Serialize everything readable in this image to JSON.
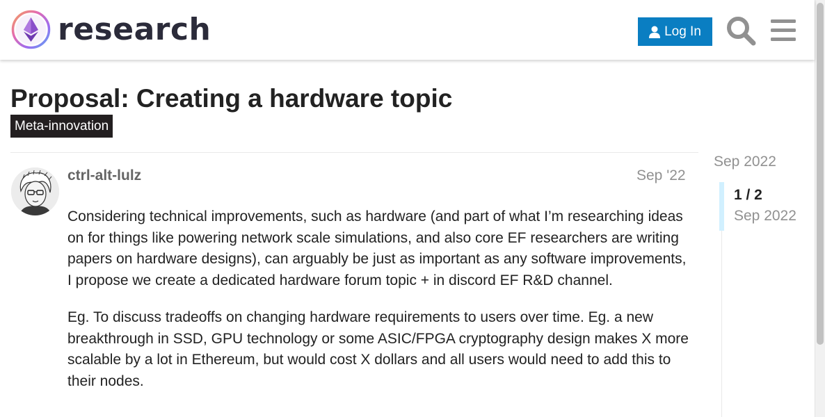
{
  "header": {
    "site_name": "research",
    "login_label": "Log In",
    "icons": {
      "logo": "ethereum-logo-icon",
      "user": "user-icon",
      "search": "search-icon",
      "menu": "hamburger-menu-icon"
    }
  },
  "topic": {
    "title": "Proposal: Creating a hardware topic",
    "category": "Meta-innovation"
  },
  "post": {
    "username": "ctrl-alt-lulz",
    "date": "Sep '22",
    "paragraphs": [
      "Considering technical improvements, such as hardware (and part of what I’m researching ideas on for things like powering network scale simulations, and also core EF researchers are writing papers on hardware designs), can arguably be just as important as any software improvements, I propose we create a dedicated hardware forum topic + in discord EF R&D channel.",
      "Eg. To discuss tradeoffs on changing hardware requirements to users over time. Eg. a new breakthrough in SSD, GPU technology or some ASIC/FPGA cryptography design makes X more scalable by a lot in Ethereum, but would cost X dollars and all users would need to add this to their nodes."
    ]
  },
  "timeline": {
    "start_date": "Sep 2022",
    "position": "1 / 2",
    "current_date": "Sep 2022"
  },
  "colors": {
    "login_bg": "#0a7ec2",
    "category_bg": "#231f20",
    "muted_text": "#919191",
    "timeline_handle": "#d1f0ff"
  }
}
